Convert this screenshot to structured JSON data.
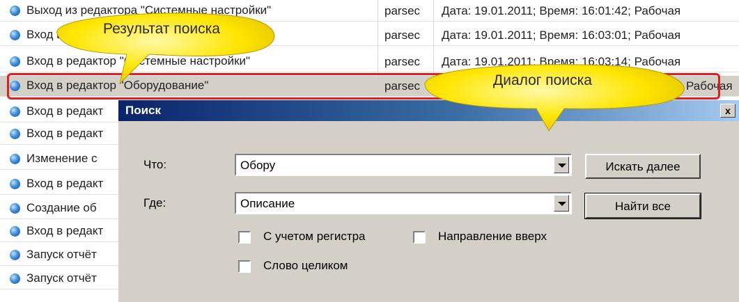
{
  "list": {
    "rows": [
      {
        "desc": "Выход из редактора \"Системные настройки\"",
        "user": "parsec",
        "info": "Дата: 19.01.2011; Время: 16:01:42; Рабочая"
      },
      {
        "desc": "Вход в редактор",
        "user": "parsec",
        "info": "Дата: 19.01.2011; Время: 16:03:01; Рабочая"
      },
      {
        "desc": "Вход в редактор \"Системные настройки\"",
        "user": "parsec",
        "info": "Дата: 19.01.2011; Время: 16:03:14; Рабочая"
      },
      {
        "desc": "Вход в редактор \"Оборудование\"",
        "user": "parsec",
        "info": "Рабочая"
      },
      {
        "desc": "Вход в редакт",
        "user": "",
        "info": ""
      },
      {
        "desc": "Вход в редакт",
        "user": "",
        "info": ""
      },
      {
        "desc": "Изменение с",
        "user": "",
        "info": ""
      },
      {
        "desc": "Вход в редакт",
        "user": "",
        "info": ""
      },
      {
        "desc": "Создание об",
        "user": "",
        "info": ""
      },
      {
        "desc": "Вход в редакт",
        "user": "",
        "info": ""
      },
      {
        "desc": "Запуск отчёт",
        "user": "",
        "info": ""
      },
      {
        "desc": "Запуск отчёт",
        "user": "",
        "info": ""
      }
    ]
  },
  "callouts": {
    "search_result": "Результат поиска",
    "search_dialog": "Диалог поиска"
  },
  "dialog": {
    "title": "Поиск",
    "close_label": "x",
    "what_label": "Что:",
    "what_value": "Обору",
    "where_label": "Где:",
    "where_value": "Описание",
    "find_next_label": "Искать далее",
    "find_all_label": "Найти все",
    "match_case_label": "С учетом регистра",
    "direction_up_label": "Направление вверх",
    "whole_word_label": "Слово целиком"
  },
  "colors": {
    "highlight_border": "#e02020",
    "callout_fill": "#ffe600",
    "titlebar_start": "#0a246a"
  }
}
